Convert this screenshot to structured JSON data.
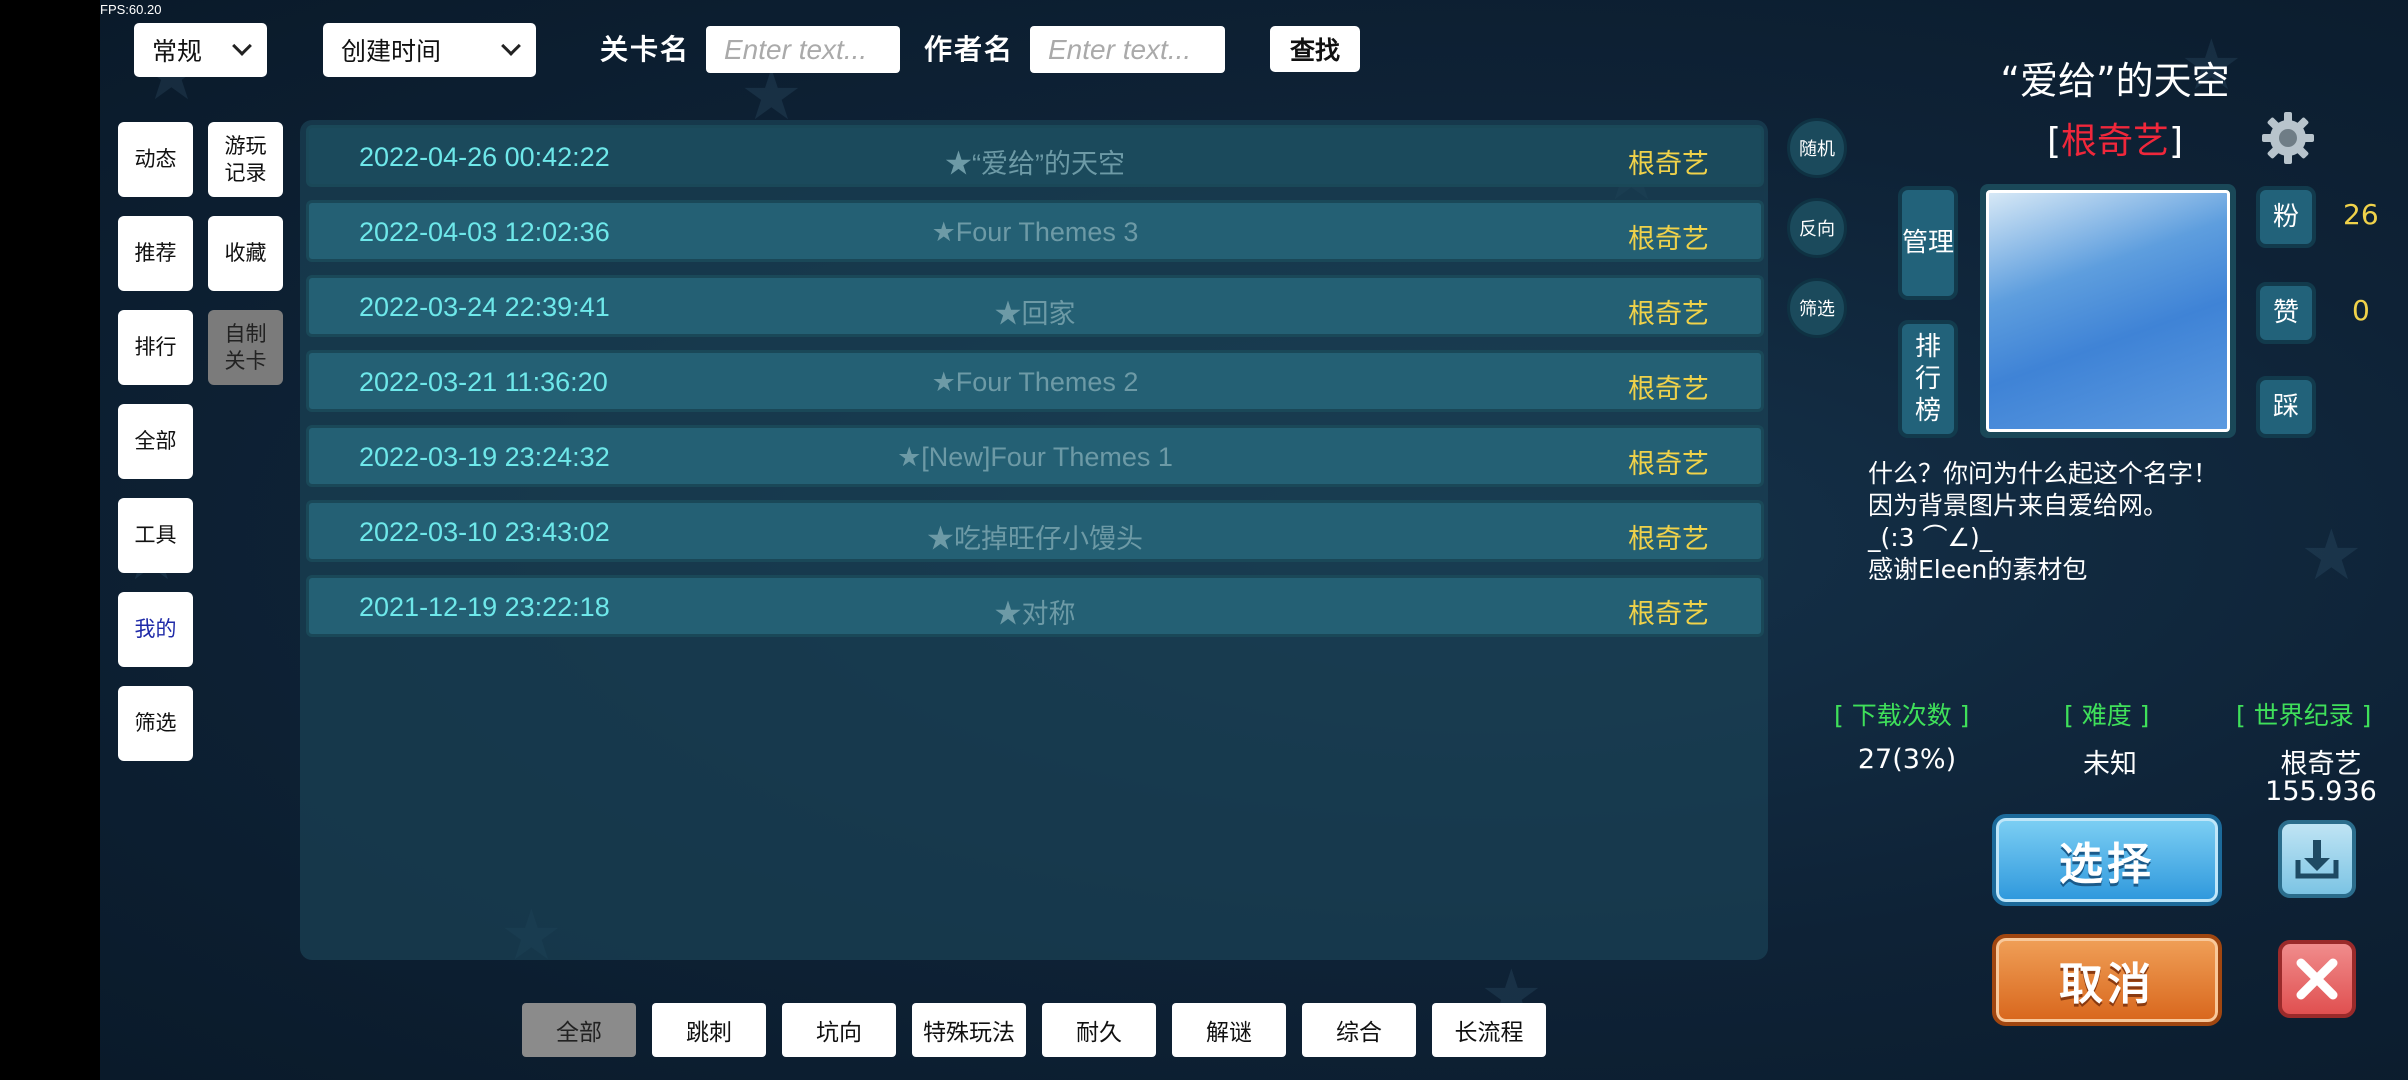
{
  "fps": "FPS:60.20",
  "topbar": {
    "mode_select": "常规",
    "sort_select": "创建时间",
    "level_name_label": "关卡名",
    "level_name_placeholder": "Enter text...",
    "author_name_label": "作者名",
    "author_name_placeholder": "Enter text...",
    "search_button": "查找"
  },
  "left_nav": {
    "col1": [
      "动态",
      "推荐",
      "排行",
      "全部",
      "工具",
      "我的",
      "筛选"
    ],
    "col2": [
      "游玩记录",
      "收藏",
      "自制关卡"
    ],
    "active": "我的"
  },
  "levels": [
    {
      "date": "2022-04-26 00:42:22",
      "title": "★“爱给”的天空",
      "author": "根奇艺"
    },
    {
      "date": "2022-04-03 12:02:36",
      "title": "★Four Themes  3",
      "author": "根奇艺"
    },
    {
      "date": "2022-03-24 22:39:41",
      "title": "★回家",
      "author": "根奇艺"
    },
    {
      "date": "2022-03-21 11:36:20",
      "title": "★Four Themes  2",
      "author": "根奇艺"
    },
    {
      "date": "2022-03-19 23:24:32",
      "title": "★[New]Four Themes  1",
      "author": "根奇艺"
    },
    {
      "date": "2022-03-10 23:43:02",
      "title": "★吃掉旺仔小馒头",
      "author": "根奇艺"
    },
    {
      "date": "2021-12-19 23:22:18",
      "title": "★对称",
      "author": "根奇艺"
    }
  ],
  "side_buttons": {
    "random": "随机",
    "reverse": "反向",
    "filter": "筛选"
  },
  "category_tabs": [
    "全部",
    "跳刺",
    "坑向",
    "特殊玩法",
    "耐久",
    "解谜",
    "综合",
    "长流程"
  ],
  "detail": {
    "title": "“爱给”的天空",
    "author_open": "[",
    "author": "根奇艺",
    "author_close": "]",
    "manage_button": "管理",
    "leaderboard_button": "排行榜",
    "fans_button": "粉",
    "fans_count": "26",
    "likes_button": "赞",
    "likes_count": "0",
    "dislike_button": "踩",
    "description": "什么？你问为什么起这个名字！\n因为背景图片来自爱给网。\n_(:3 ⌒∠)_\n感谢Eleen的素材包",
    "downloads_label": "[ 下载次数 ]",
    "downloads_value": "27(3%)",
    "difficulty_label": "[ 难度 ]",
    "difficulty_value": "未知",
    "record_label": "[ 世界纪录 ]",
    "record_holder": "根奇艺",
    "record_time": "155.936",
    "select_button": "选择",
    "cancel_button": "取消"
  }
}
